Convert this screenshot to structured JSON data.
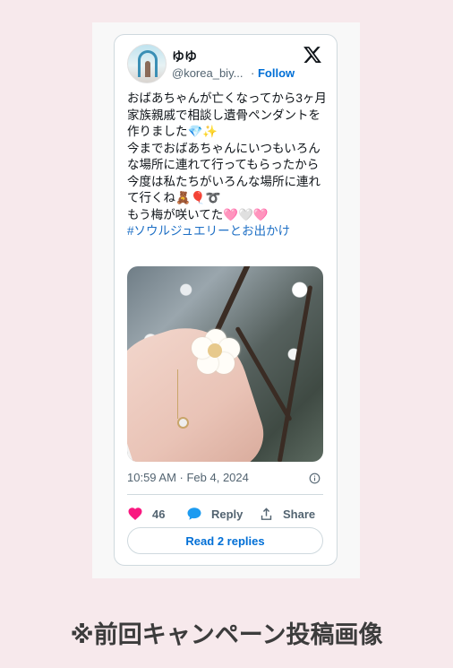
{
  "tweet": {
    "display_name": "ゆゆ",
    "handle": "@korea_biy...",
    "follow_separator": "·",
    "follow_label": "Follow",
    "logo": "x-logo-icon",
    "text_lines": [
      "おばあちゃんが亡くなってから3ヶ月",
      "家族親戚で相談し遺骨ペンダントを作りました💎✨",
      "今までおばあちゃんにいつもいろんな場所に連れて行ってもらったから今度は私たちがいろんな場所に連れて行くね🧸🎈➰",
      "もう梅が咲いてた🩷🤍🩷"
    ],
    "hashtag": "#ソウルジュエリーとお出かけ",
    "image": "photo of a hand holding a white plum blossom with a pendant necklace",
    "timestamp": "10:59 AM · Feb 4, 2024",
    "info_icon": "info-icon",
    "actions": {
      "likes_count": "46",
      "reply_label": "Reply",
      "share_label": "Share"
    },
    "read_replies_label": "Read 2 replies"
  },
  "caption": "※前回キャンペーン投稿画像",
  "colors": {
    "page_background": "#f7e9ec",
    "link_blue": "#006fd6",
    "like_pink": "#f91880",
    "reply_blue": "#1d9bf0",
    "muted_text": "#536471"
  }
}
